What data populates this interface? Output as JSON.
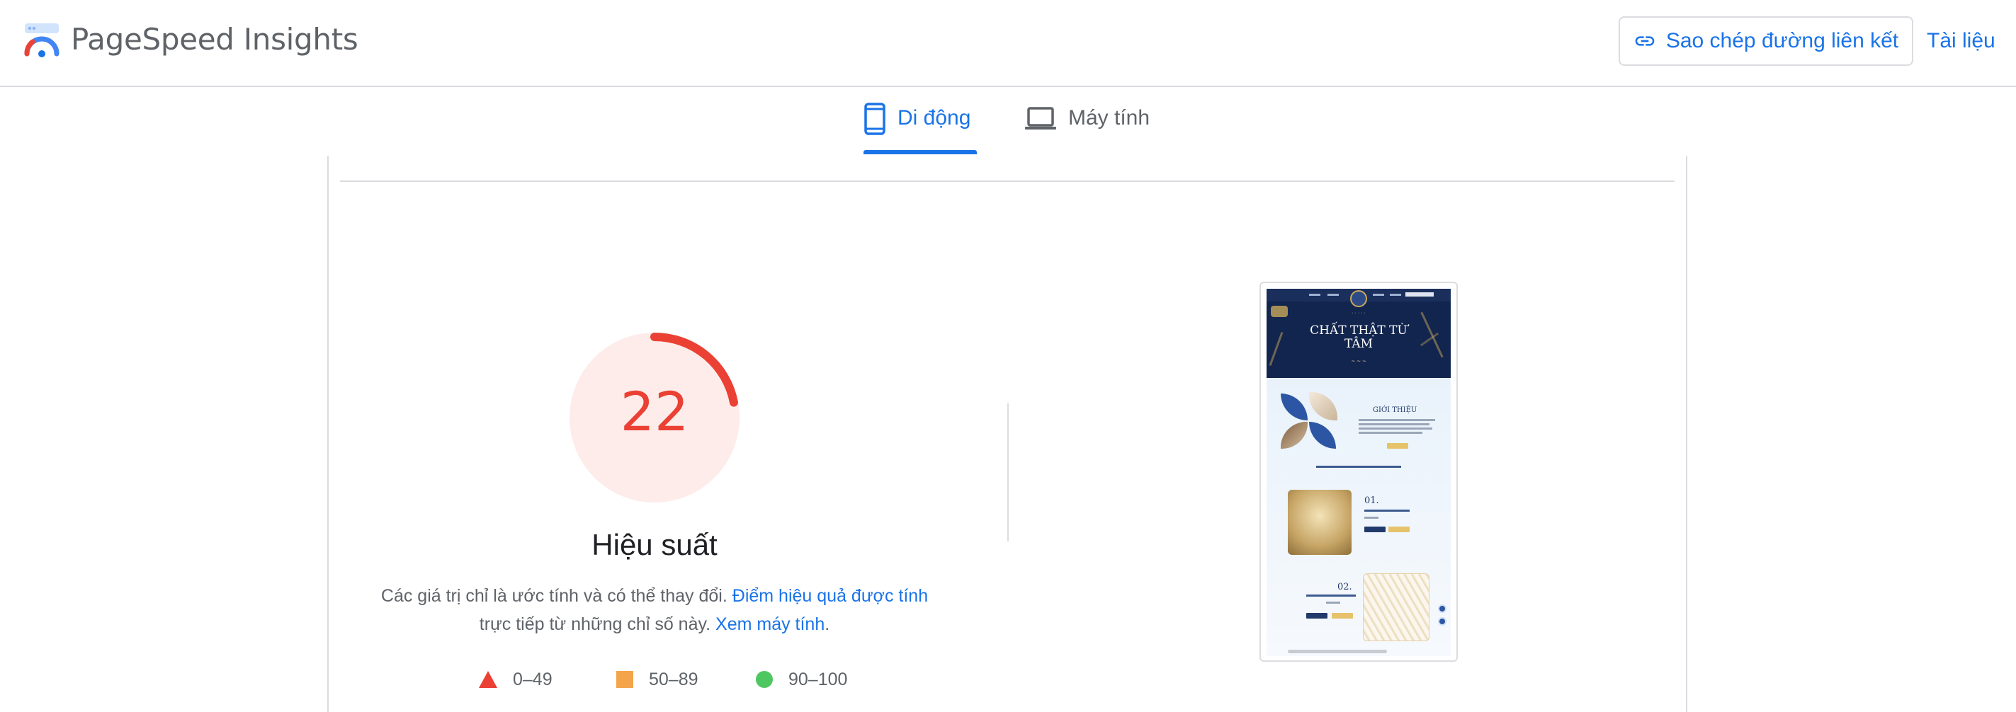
{
  "header": {
    "brand": "PageSpeed Insights",
    "copy_link_label": "Sao chép đường liên kết",
    "docs_label": "Tài liệu"
  },
  "tabs": [
    {
      "label": "Di động",
      "active": true
    },
    {
      "label": "Máy tính",
      "active": false
    }
  ],
  "performance": {
    "score": "22",
    "score_value": 22,
    "title": "Hiệu suất",
    "desc_before": "Các giá trị chỉ là ước tính và có thể thay đổi. ",
    "desc_link1": "Điểm hiệu quả được tính",
    "desc_middle": " trực tiếp từ những chỉ số này. ",
    "desc_link2": "Xem máy tính",
    "desc_end": "."
  },
  "legend": [
    {
      "range": "0–49",
      "shape": "triangle",
      "color": "#eb4034"
    },
    {
      "range": "50–89",
      "shape": "square",
      "color": "#f4a44a"
    },
    {
      "range": "90–100",
      "shape": "circle",
      "color": "#4fc761"
    }
  ],
  "screenshot": {
    "hero_title": "CHẤT THẬT TỪ TÂM",
    "section_heading": "GIỚI THIỆU",
    "item1_number": "01.",
    "item2_number": "02."
  },
  "colors": {
    "accent": "#1a73e8",
    "fail": "#eb4034",
    "fail_bg": "#fdecea",
    "border": "#dadce0",
    "muted_text": "#5f6368"
  }
}
